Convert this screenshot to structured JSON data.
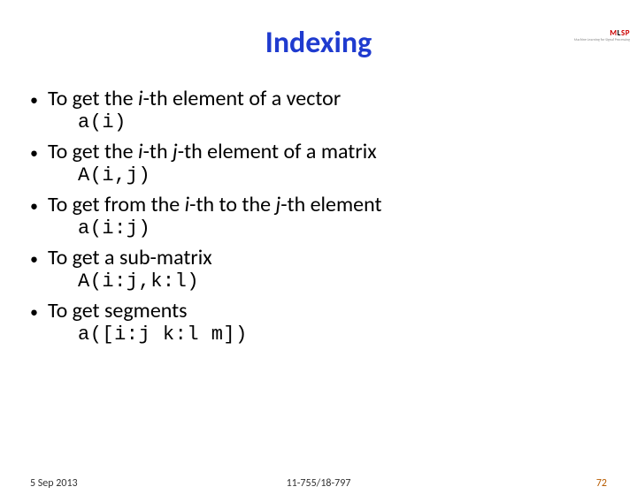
{
  "logo": {
    "m": "M",
    "l": "L",
    "s": "S",
    "p": "P",
    "sub": "Machine Learning for Signal Processing"
  },
  "title": "Indexing",
  "bullets": [
    {
      "pre": "To get the ",
      "i1": "i",
      "post": "-th element of a vector",
      "code": "a(i)"
    },
    {
      "pre": "To get the ",
      "i1": "i",
      "mid": "-th ",
      "i2": "j",
      "post": "-th element of a matrix",
      "code": "A(i,j)"
    },
    {
      "pre": "To get from the ",
      "i1": "i",
      "mid": "-th to the ",
      "i2": "j",
      "post": "-th element",
      "code": "a(i:j)"
    },
    {
      "pre": "To get a sub-matrix",
      "code": "A(i:j,k:l)"
    },
    {
      "pre": "To get segments",
      "code": "a([i:j k:l m])"
    }
  ],
  "footer": {
    "date": "5 Sep 2013",
    "course": "11-755/18-797",
    "page": "72"
  }
}
